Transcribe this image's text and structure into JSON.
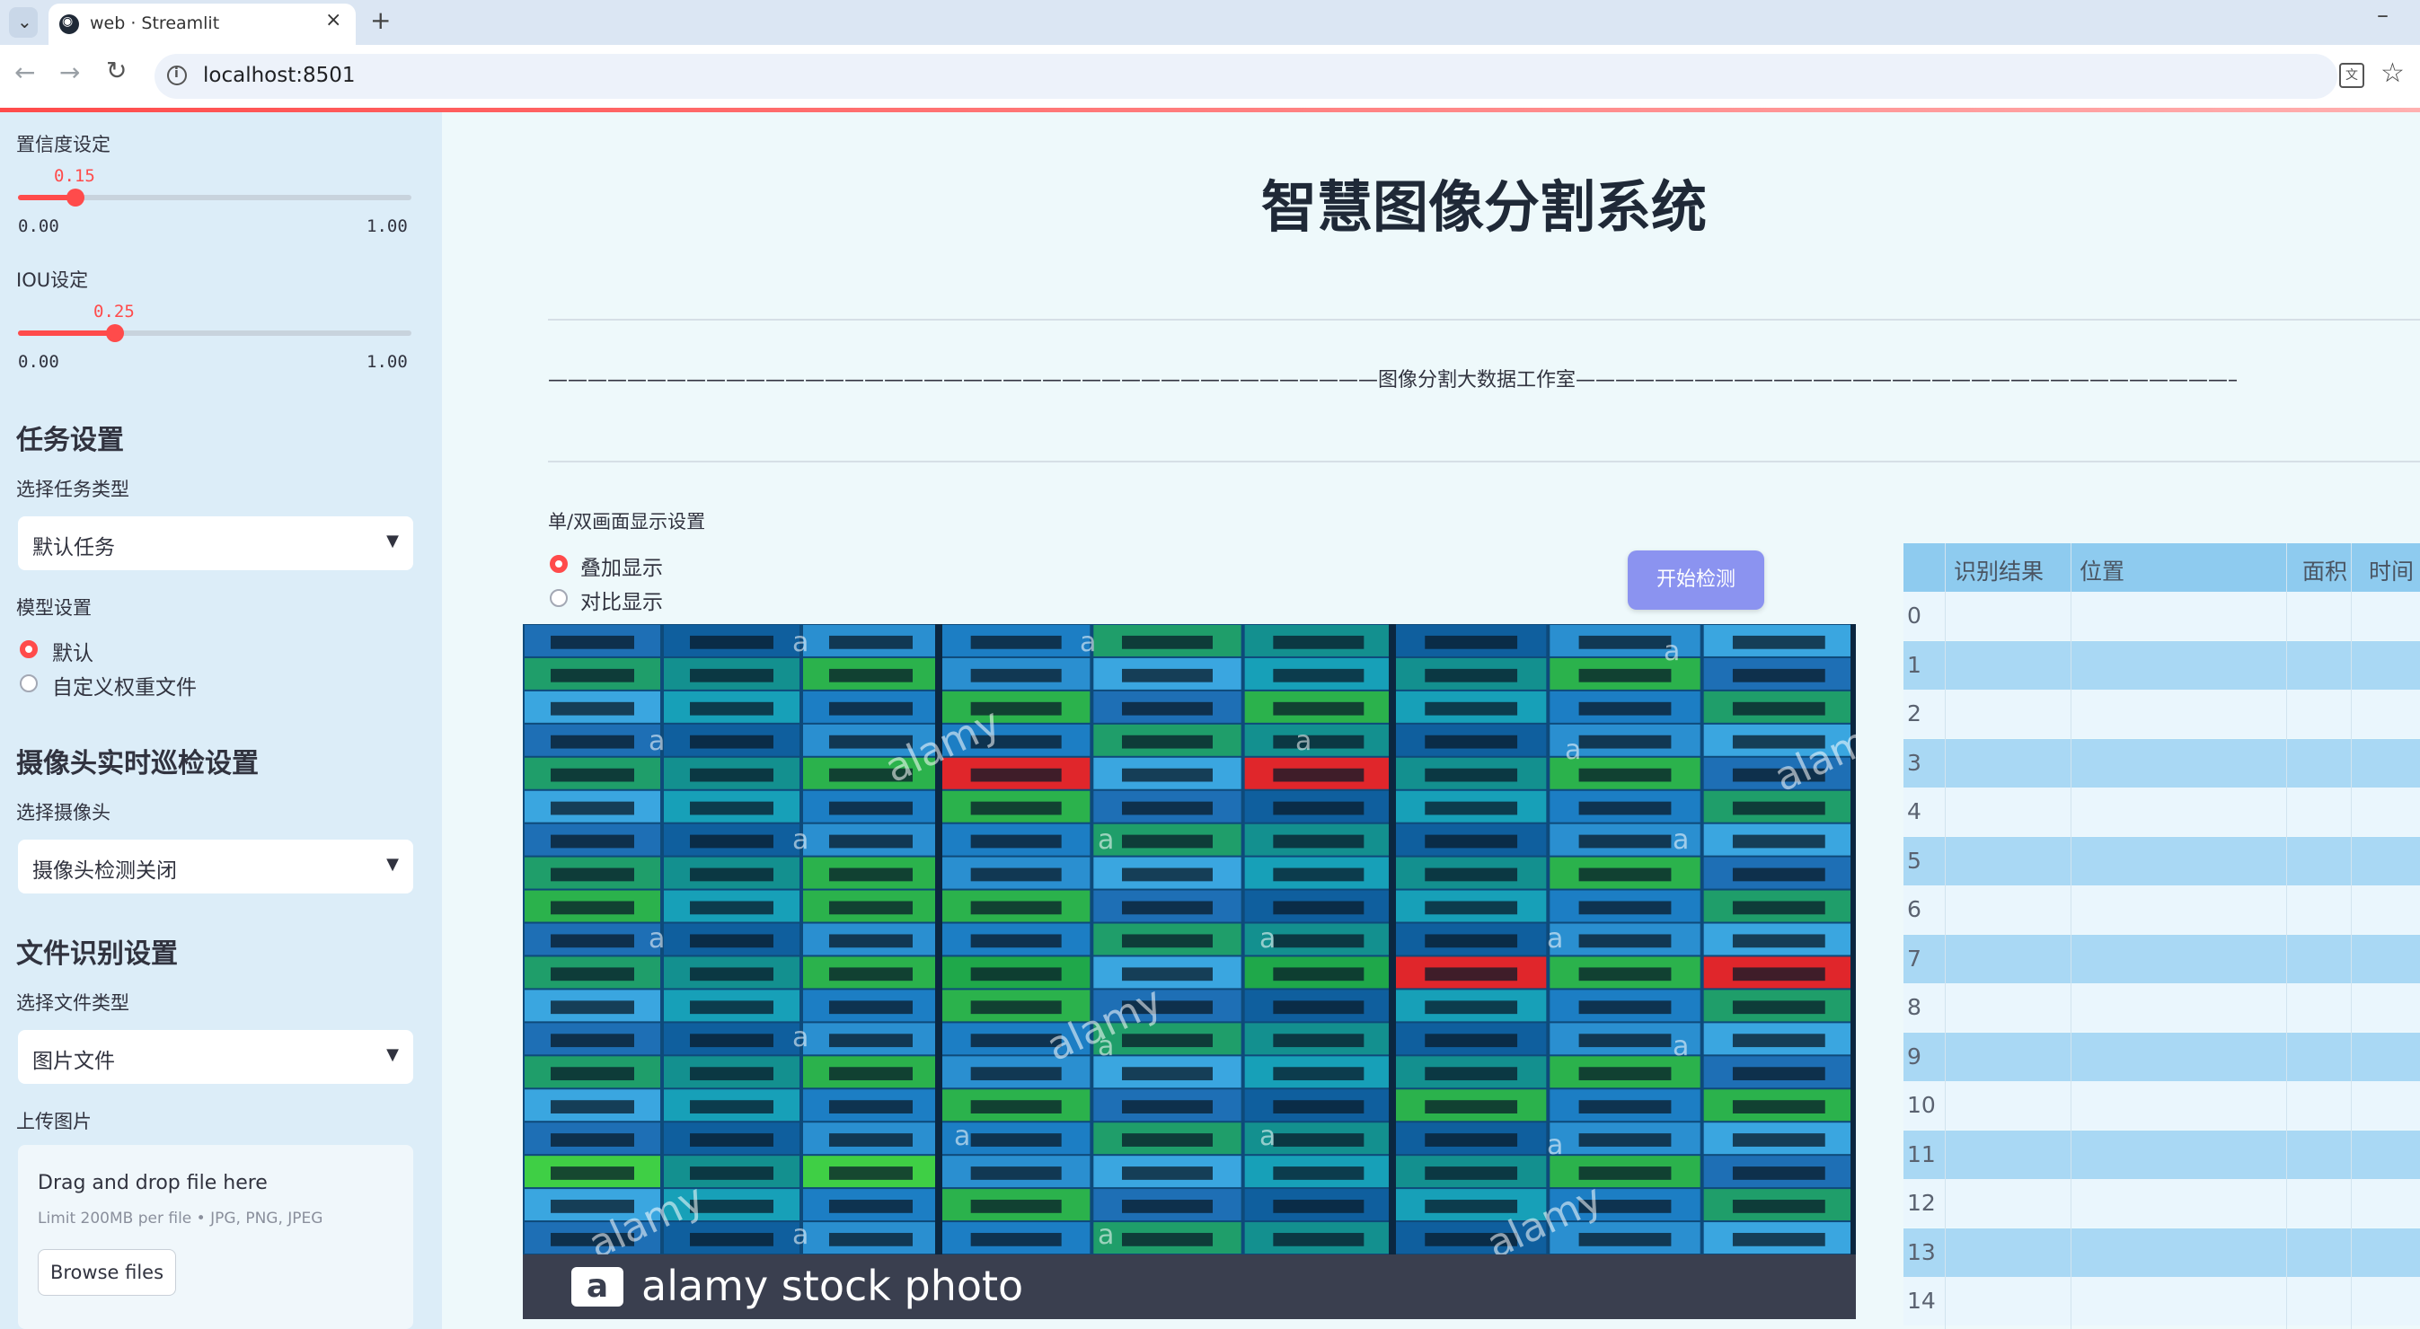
{
  "browser": {
    "tab_title": "web · Streamlit",
    "url": "localhost:8501",
    "close_glyph": "×",
    "new_tab_glyph": "+",
    "minimize_glyph": "–"
  },
  "sidebar": {
    "confidence": {
      "label": "置信度设定",
      "value": "0.15",
      "min": "0.00",
      "max": "1.00",
      "fraction": 0.15
    },
    "iou": {
      "label": "IOU设定",
      "value": "0.25",
      "min": "0.00",
      "max": "1.00",
      "fraction": 0.25
    },
    "task_section": {
      "title": "任务设置",
      "select_label": "选择任务类型",
      "selected": "默认任务"
    },
    "model_section": {
      "label": "模型设置",
      "options": [
        "默认",
        "自定义权重文件"
      ],
      "selected_index": 0
    },
    "camera_section": {
      "title": "摄像头实时巡检设置",
      "select_label": "选择摄像头",
      "selected": "摄像头检测关闭"
    },
    "file_section": {
      "title": "文件识别设置",
      "select_label": "选择文件类型",
      "selected": "图片文件"
    },
    "upload": {
      "label": "上传图片",
      "drop_text": "Drag and drop file here",
      "limit_text": "Limit 200MB per file • JPG, PNG, JPEG",
      "browse_label": "Browse files"
    }
  },
  "main": {
    "title": "智慧图像分割系统",
    "divider_text": "——————————————————————————————————————————图像分割大数据工作室——————————————————————————————————————————",
    "display_setting": {
      "label": "单/双画面显示设置",
      "options": [
        "叠加显示",
        "对比显示"
      ],
      "selected_index": 0
    },
    "start_button": "开始检测",
    "image": {
      "caption": "alamy stock photo",
      "logo_letter": "a",
      "watermark": "alamy",
      "watermark_letter": "a"
    },
    "table": {
      "columns": [
        "识别结果",
        "位置",
        "面积",
        "时间"
      ],
      "row_indices": [
        "0",
        "1",
        "2",
        "3",
        "4",
        "5",
        "6",
        "7",
        "8",
        "9",
        "10",
        "11",
        "12",
        "13",
        "14"
      ]
    }
  },
  "colors": {
    "accent": "#ff4b4b",
    "button": "#8b93f0",
    "sidebar_bg": "#dcedf8",
    "table_header": "#8ecbef",
    "table_odd": "#a9d8f4"
  }
}
